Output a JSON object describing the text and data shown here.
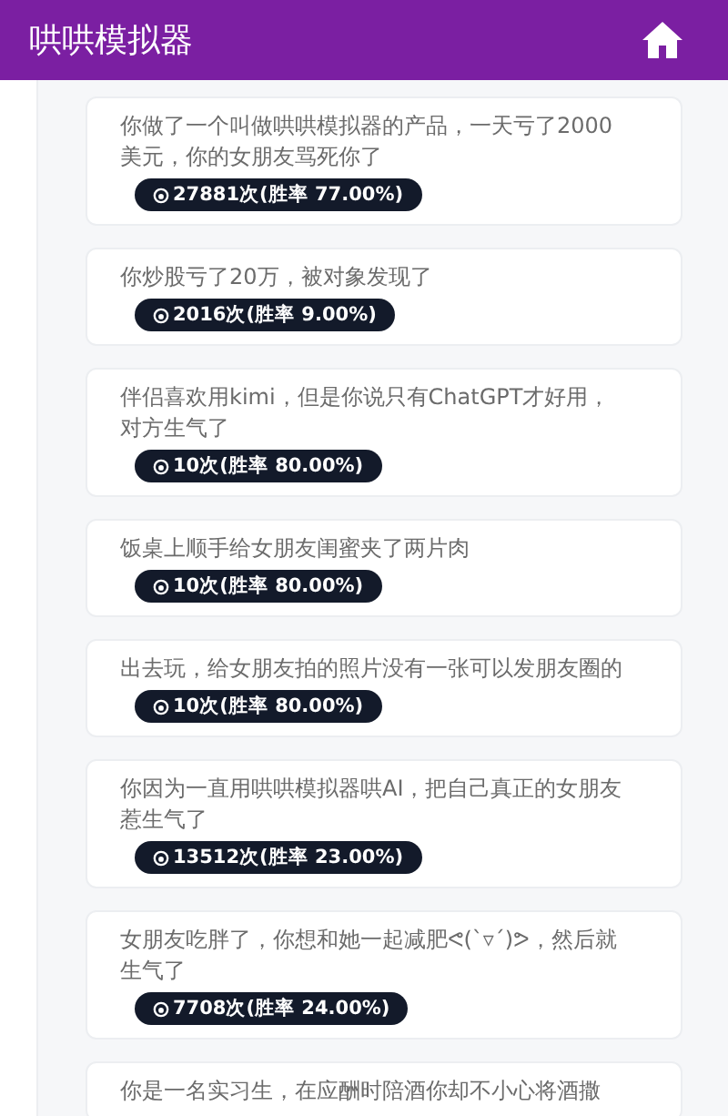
{
  "header": {
    "title": "哄哄模拟器"
  },
  "scenarios": [
    {
      "text": "你做了一个叫做哄哄模拟器的产品，一天亏了2000美元，你的女朋友骂死你了",
      "stats": "27881次(胜率 77.00%)"
    },
    {
      "text": "你炒股亏了20万，被对象发现了",
      "stats": "2016次(胜率 9.00%)"
    },
    {
      "text": "伴侣喜欢用kimi，但是你说只有ChatGPT才好用，对方生气了",
      "stats": "10次(胜率 80.00%)"
    },
    {
      "text": "饭桌上顺手给女朋友闺蜜夹了两片肉",
      "stats": "10次(胜率 80.00%)"
    },
    {
      "text": "出去玩，给女朋友拍的照片没有一张可以发朋友圈的",
      "stats": "10次(胜率 80.00%)"
    },
    {
      "text": "你因为一直用哄哄模拟器哄AI，把自己真正的女朋友惹生气了",
      "stats": "13512次(胜率 23.00%)"
    },
    {
      "text": "女朋友吃胖了，你想和她一起减肥ᕙ(`▿´)ᕗ，然后就生气了",
      "stats": "7708次(胜率 24.00%)"
    },
    {
      "text": "你是一名实习生，在应酬时陪酒你却不小心将酒撒"
    }
  ]
}
